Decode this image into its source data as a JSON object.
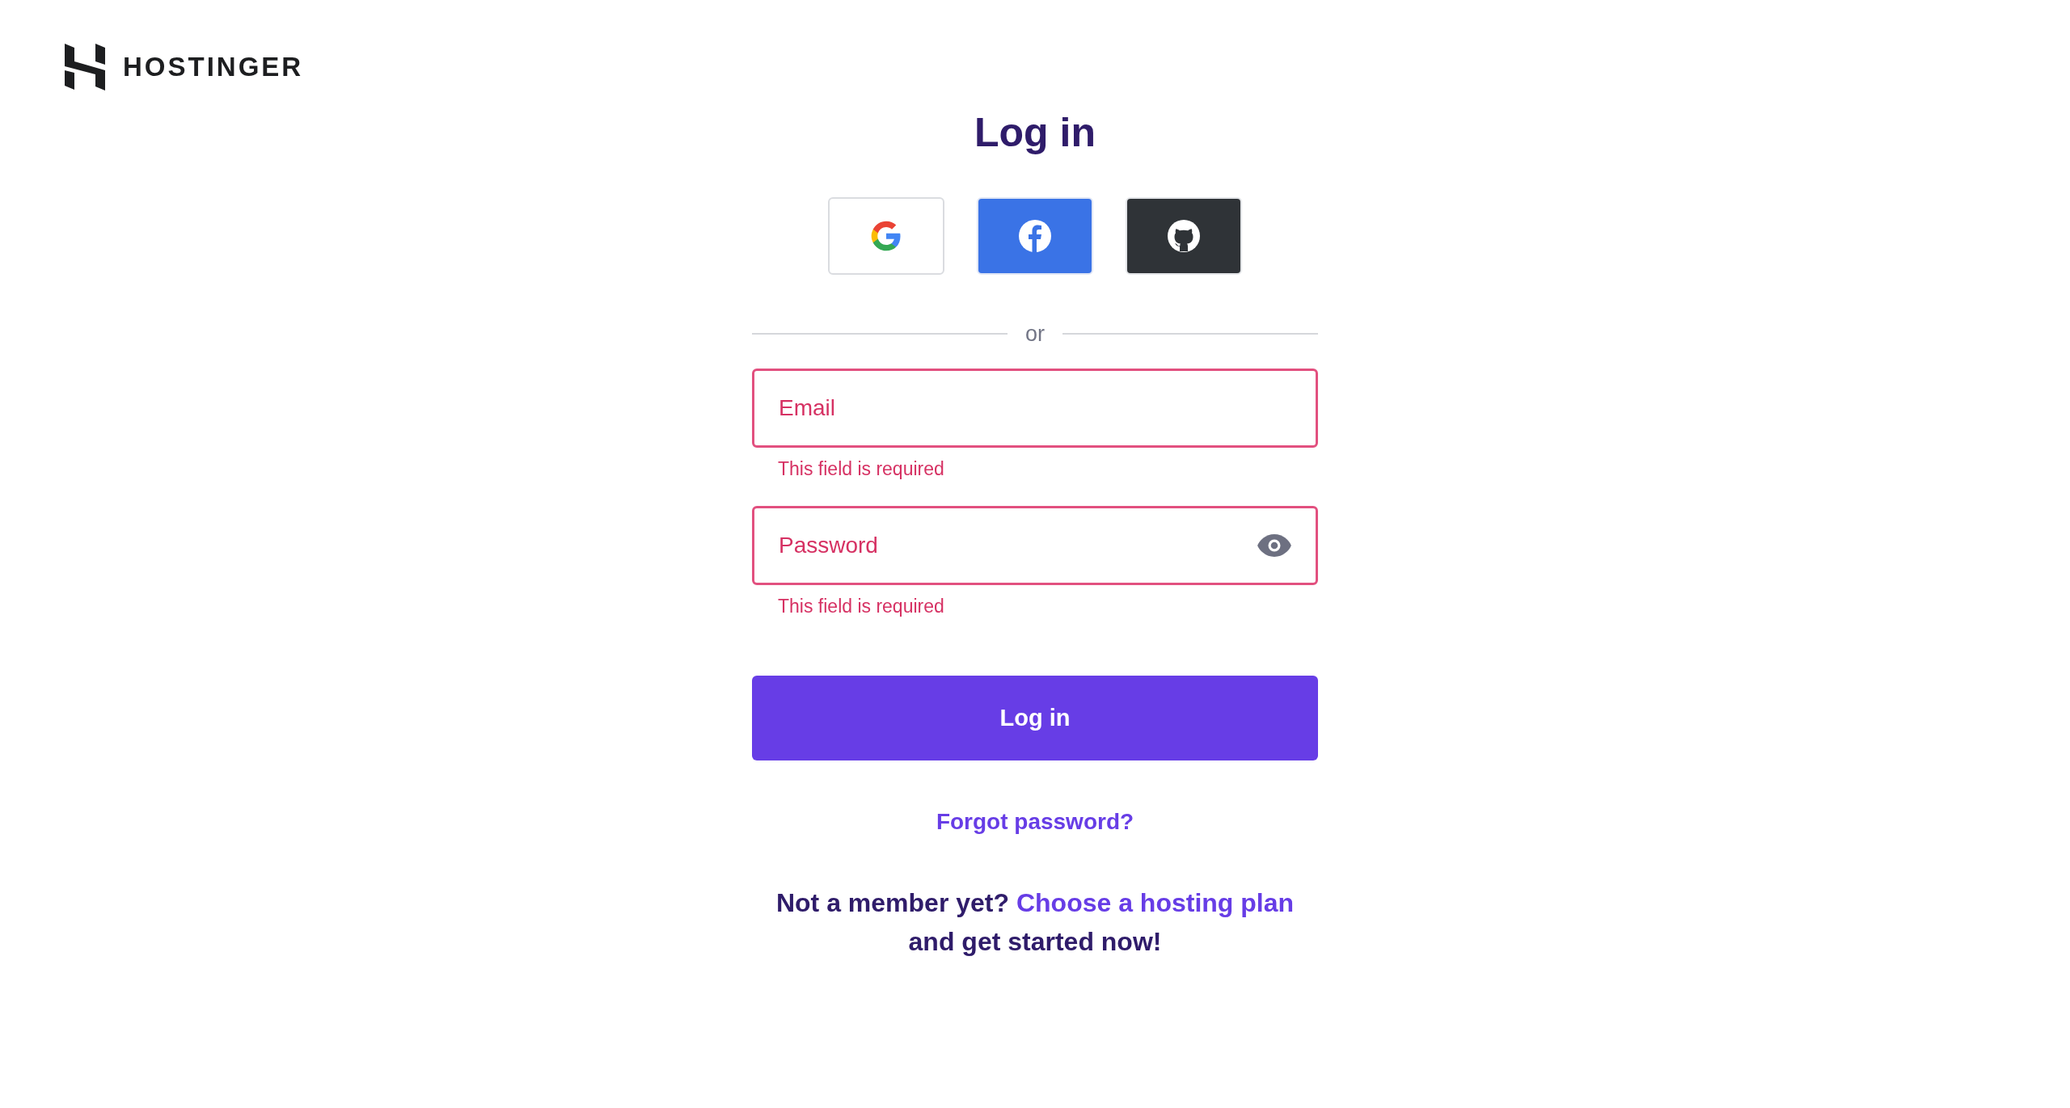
{
  "brand": {
    "name": "HOSTINGER"
  },
  "title": "Log in",
  "social_buttons": [
    {
      "kind": "google"
    },
    {
      "kind": "facebook"
    },
    {
      "kind": "github"
    }
  ],
  "divider": "or",
  "fields": [
    {
      "placeholder": "Email",
      "invalid": true,
      "error": "This field is required"
    },
    {
      "placeholder": "Password",
      "invalid": true,
      "error": "This field is required",
      "reveal_toggle": true
    }
  ],
  "submit": "Log in",
  "forgot": "Forgot password?",
  "signup": {
    "text": "Not a member yet?",
    "link": "Choose a hosting plan",
    "after": "and get started now!"
  }
}
